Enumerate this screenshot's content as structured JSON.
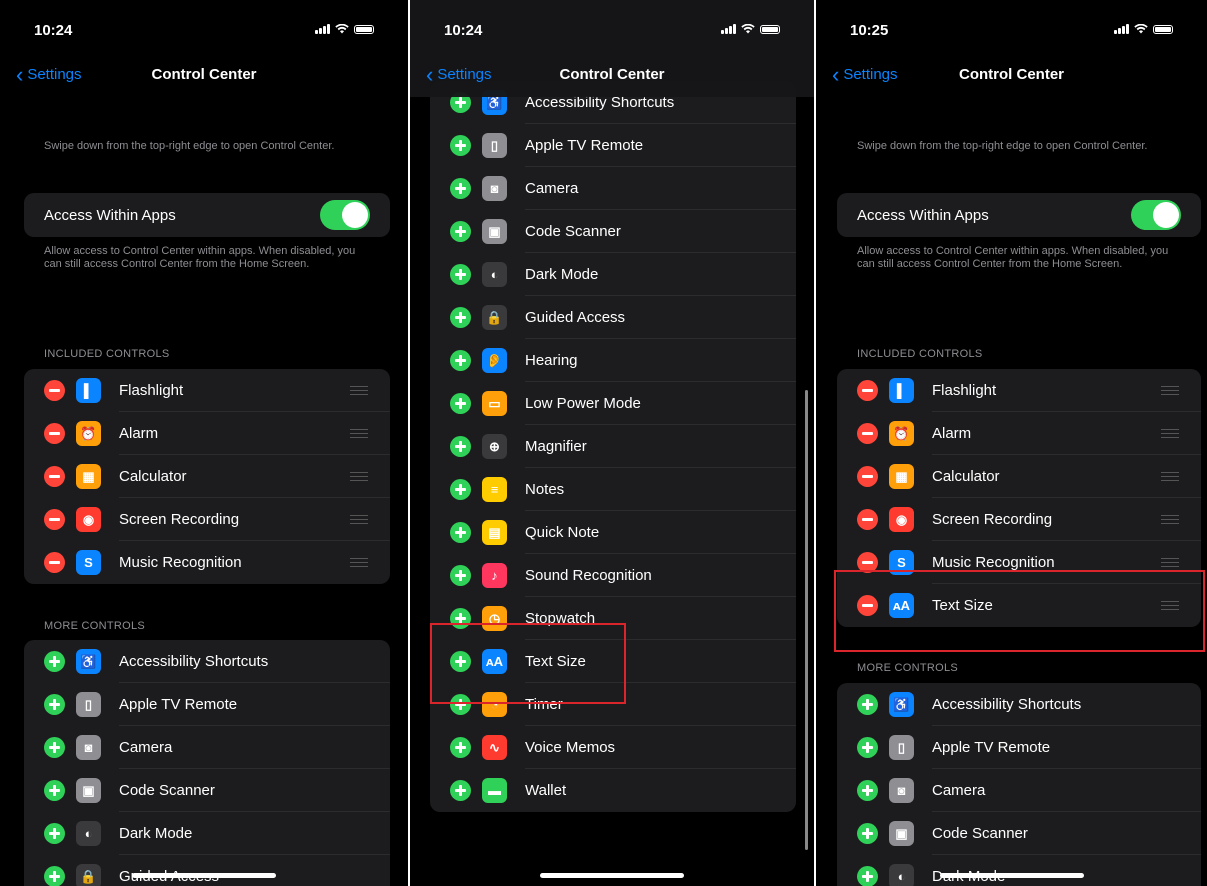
{
  "panels": [
    {
      "time": "10:24",
      "back_label": "Settings",
      "title": "Control Center",
      "note": "Swipe down from the top-right edge to open Control Center.",
      "toggle_label": "Access Within Apps",
      "toggle_on": true,
      "toggle_note": "Allow access to Control Center within apps. When disabled, you can still access Control Center from the Home Screen.",
      "included_header": "INCLUDED CONTROLS",
      "more_header": "MORE CONTROLS"
    },
    {
      "time": "10:24",
      "back_label": "Settings",
      "title": "Control Center"
    },
    {
      "time": "10:25",
      "back_label": "Settings",
      "title": "Control Center",
      "note": "Swipe down from the top-right edge to open Control Center.",
      "toggle_label": "Access Within Apps",
      "toggle_on": true,
      "toggle_note": "Allow access to Control Center within apps. When disabled, you can still access Control Center from the Home Screen.",
      "included_header": "INCLUDED CONTROLS",
      "more_header": "MORE CONTROLS"
    }
  ],
  "controls": {
    "flashlight": {
      "label": "Flashlight",
      "color": "#0a84ff",
      "glyph": "▌",
      "icon": "flashlight-icon"
    },
    "alarm": {
      "label": "Alarm",
      "color": "#ff9f0a",
      "glyph": "⏰",
      "icon": "alarm-icon"
    },
    "calculator": {
      "label": "Calculator",
      "color": "#ff9f0a",
      "glyph": "▦",
      "icon": "calculator-icon"
    },
    "screen_recording": {
      "label": "Screen Recording",
      "color": "#ff3b30",
      "glyph": "◉",
      "icon": "screen-recording-icon"
    },
    "music_recognition": {
      "label": "Music Recognition",
      "color": "#0a84ff",
      "glyph": "S",
      "icon": "shazam-icon"
    },
    "text_size": {
      "label": "Text Size",
      "color": "#0a84ff",
      "glyph": "ᴀA",
      "icon": "text-size-icon"
    },
    "accessibility": {
      "label": "Accessibility Shortcuts",
      "color": "#0a84ff",
      "glyph": "♿",
      "icon": "accessibility-icon"
    },
    "apple_tv": {
      "label": "Apple TV Remote",
      "color": "#8e8e93",
      "glyph": "▯",
      "icon": "tv-remote-icon"
    },
    "camera": {
      "label": "Camera",
      "color": "#8e8e93",
      "glyph": "◙",
      "icon": "camera-icon"
    },
    "code_scanner": {
      "label": "Code Scanner",
      "color": "#8e8e93",
      "glyph": "▣",
      "icon": "qr-code-icon"
    },
    "dark_mode": {
      "label": "Dark Mode",
      "color": "#3a3a3c",
      "glyph": "◐",
      "icon": "dark-mode-icon"
    },
    "guided_access": {
      "label": "Guided Access",
      "color": "#3a3a3c",
      "glyph": "🔒",
      "icon": "lock-icon"
    },
    "hearing": {
      "label": "Hearing",
      "color": "#0a84ff",
      "glyph": "👂",
      "icon": "ear-icon"
    },
    "low_power": {
      "label": "Low Power Mode",
      "color": "#ff9f0a",
      "glyph": "▭",
      "icon": "battery-icon"
    },
    "magnifier": {
      "label": "Magnifier",
      "color": "#3a3a3c",
      "glyph": "⊕",
      "icon": "magnifier-icon"
    },
    "notes": {
      "label": "Notes",
      "color": "#ffcc00",
      "glyph": "≡",
      "icon": "notes-icon"
    },
    "quick_note": {
      "label": "Quick Note",
      "color": "#ffcc00",
      "glyph": "▤",
      "icon": "quick-note-icon"
    },
    "sound_recognition": {
      "label": "Sound Recognition",
      "color": "#ff375f",
      "glyph": "♪",
      "icon": "sound-recognition-icon"
    },
    "stopwatch": {
      "label": "Stopwatch",
      "color": "#ff9f0a",
      "glyph": "◷",
      "icon": "stopwatch-icon"
    },
    "timer": {
      "label": "Timer",
      "color": "#ff9f0a",
      "glyph": "◔",
      "icon": "timer-icon"
    },
    "voice_memos": {
      "label": "Voice Memos",
      "color": "#ff3b30",
      "glyph": "∿",
      "icon": "voice-memos-icon"
    },
    "wallet": {
      "label": "Wallet",
      "color": "#30d158",
      "glyph": "▬",
      "icon": "wallet-icon"
    }
  },
  "p1_included": [
    "flashlight",
    "alarm",
    "calculator",
    "screen_recording",
    "music_recognition"
  ],
  "p1_more": [
    "accessibility",
    "apple_tv",
    "camera",
    "code_scanner",
    "dark_mode",
    "guided_access"
  ],
  "p2_more": [
    "accessibility",
    "apple_tv",
    "camera",
    "code_scanner",
    "dark_mode",
    "guided_access",
    "hearing",
    "low_power",
    "magnifier",
    "notes",
    "quick_note",
    "sound_recognition",
    "stopwatch",
    "text_size",
    "timer",
    "voice_memos",
    "wallet"
  ],
  "p3_included": [
    "flashlight",
    "alarm",
    "calculator",
    "screen_recording",
    "music_recognition",
    "text_size"
  ],
  "p3_more": [
    "accessibility",
    "apple_tv",
    "camera",
    "code_scanner",
    "dark_mode"
  ],
  "highlight_color": "#d9252b"
}
